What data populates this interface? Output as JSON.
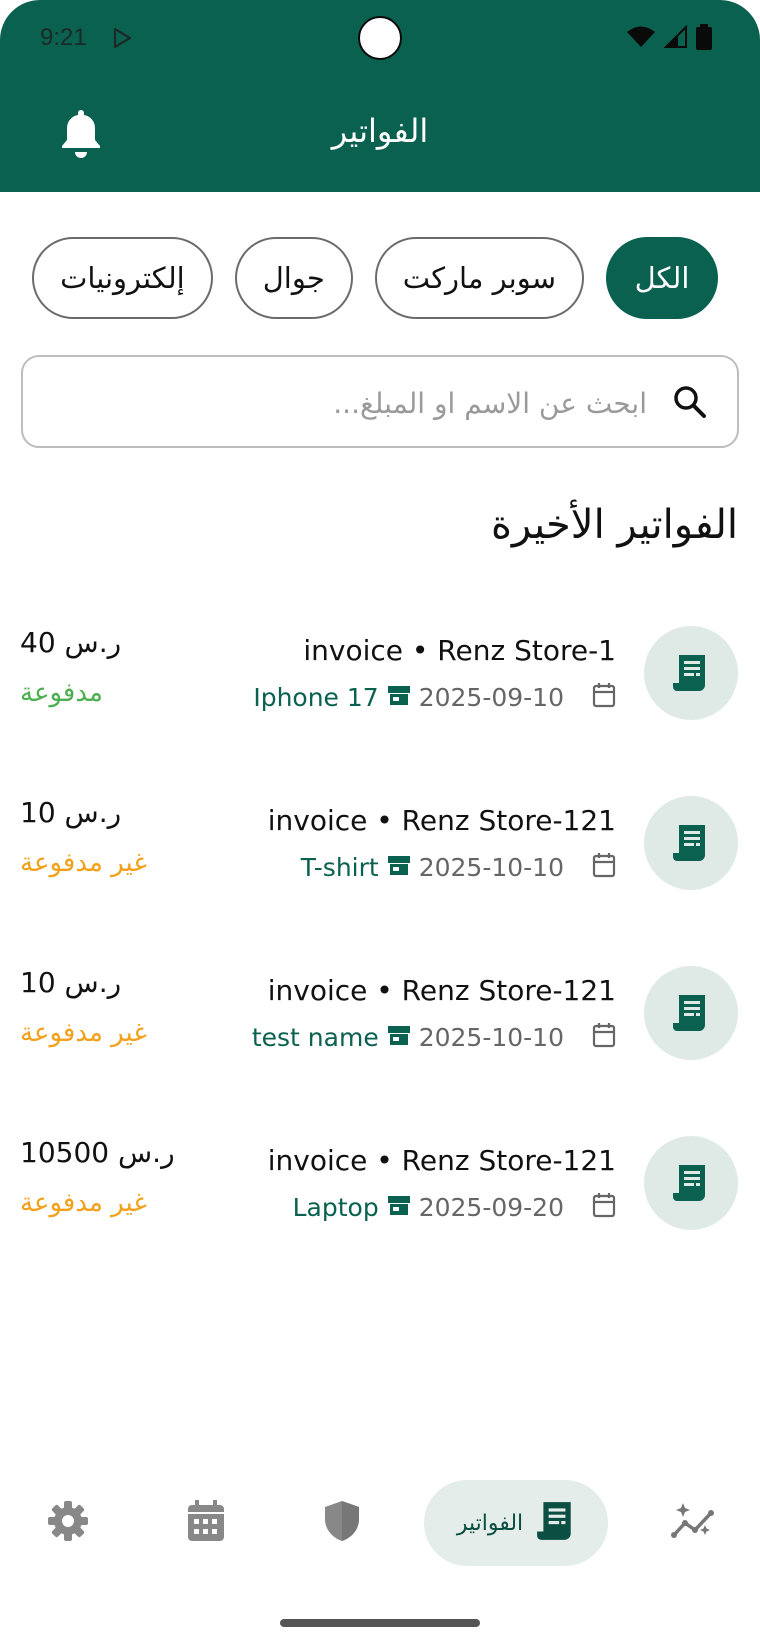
{
  "status_bar": {
    "time": "9:21"
  },
  "header": {
    "title": "الفواتير"
  },
  "filters": [
    {
      "label": "الكل",
      "active": true
    },
    {
      "label": "سوبر ماركت",
      "active": false
    },
    {
      "label": "جوال",
      "active": false
    },
    {
      "label": "إلكترونيات",
      "active": false
    }
  ],
  "search": {
    "placeholder": "ابحث عن الاسم او المبلغ...",
    "value": ""
  },
  "section_title": "الفواتير الأخيرة",
  "invoices": [
    {
      "title": "invoice • Renz Store-1",
      "date": "2025-09-10",
      "product": "Iphone 17",
      "amount": "40 ر.س",
      "status": "مدفوعة",
      "status_type": "paid"
    },
    {
      "title": "invoice • Renz Store-121",
      "date": "2025-10-10",
      "product": "T-shirt",
      "amount": "10 ر.س",
      "status": "غير مدفوعة",
      "status_type": "unpaid"
    },
    {
      "title": "invoice • Renz Store-121",
      "date": "2025-10-10",
      "product": "test name",
      "amount": "10 ر.س",
      "status": "غير مدفوعة",
      "status_type": "unpaid"
    },
    {
      "title": "invoice • Renz Store-121",
      "date": "2025-09-20",
      "product": "Laptop",
      "amount": "10500 ر.س",
      "status": "غير مدفوعة",
      "status_type": "unpaid"
    }
  ],
  "bottom_nav": {
    "items": [
      {
        "icon": "sparkle-chart-icon",
        "label": ""
      },
      {
        "icon": "invoice-icon",
        "label": "الفواتير",
        "active": true
      },
      {
        "icon": "shield-icon",
        "label": ""
      },
      {
        "icon": "calendar-icon",
        "label": ""
      },
      {
        "icon": "gear-icon",
        "label": ""
      }
    ]
  },
  "colors": {
    "primary": "#0b6150",
    "paid": "#4caf50",
    "unpaid": "#f2a11c",
    "chip_active_text": "#ffffff"
  }
}
